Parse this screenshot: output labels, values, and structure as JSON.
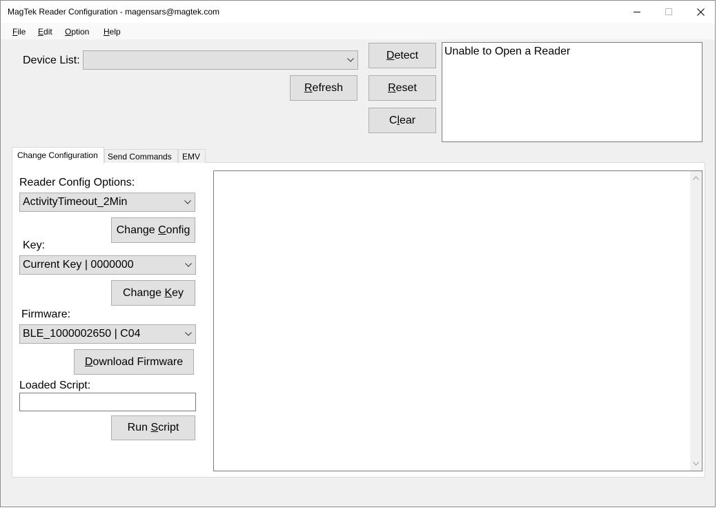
{
  "window": {
    "title": "MagTek Reader Configuration - magensars@magtek.com",
    "minimize_icon": "minimize-icon",
    "maximize_icon": "maximize-icon",
    "close_icon": "close-icon"
  },
  "menubar": {
    "items": [
      {
        "label": "File",
        "underline": "F",
        "rest": "ile"
      },
      {
        "label": "Edit",
        "underline": "E",
        "rest": "dit"
      },
      {
        "label": "Option",
        "underline": "O",
        "rest": "ption"
      },
      {
        "label": "Help",
        "underline": "H",
        "rest": "elp"
      }
    ]
  },
  "device": {
    "label": "Device List:",
    "selected": ""
  },
  "buttons": {
    "detect": {
      "pre": "",
      "ul": "D",
      "post": "etect"
    },
    "refresh": {
      "pre": "",
      "ul": "R",
      "post": "efresh"
    },
    "reset": {
      "pre": "",
      "ul": "R",
      "post": "eset"
    },
    "clear": {
      "pre": "C",
      "ul": "l",
      "post": "ear"
    },
    "change_config": {
      "pre": "Change ",
      "ul": "C",
      "post": "onfig"
    },
    "change_key": {
      "pre": "Change ",
      "ul": "K",
      "post": "ey"
    },
    "download_firmware": {
      "pre": "",
      "ul": "D",
      "post": "ownload Firmware"
    },
    "run_script": {
      "pre": "Run ",
      "ul": "S",
      "post": "cript"
    }
  },
  "status": {
    "text": "Unable to Open a Reader"
  },
  "tabs": [
    {
      "label": "Change Configuration",
      "active": true
    },
    {
      "label": "Send Commands",
      "active": false
    },
    {
      "label": "EMV",
      "active": false
    }
  ],
  "config": {
    "reader_options_label": "Reader Config Options:",
    "reader_option_selected": "ActivityTimeout_2Min",
    "key_label": "Key:",
    "key_selected": "Current Key | 0000000",
    "firmware_label": "Firmware:",
    "firmware_selected": "BLE_1000002650 | C04",
    "loaded_script_label": "Loaded Script:",
    "loaded_script_value": ""
  },
  "output": {
    "text": ""
  },
  "colors": {
    "window_bg": "#f0f0f0",
    "button_bg": "#e1e1e1",
    "button_border": "#adadad"
  }
}
